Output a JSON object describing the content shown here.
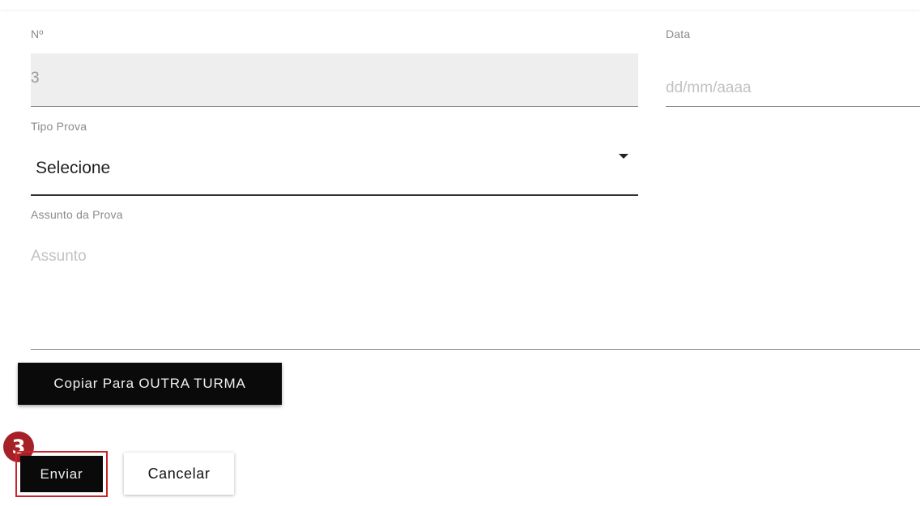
{
  "form": {
    "numero": {
      "label": "Nº",
      "value": "3"
    },
    "data": {
      "label": "Data",
      "placeholder": "dd/mm/aaaa"
    },
    "tipo_prova": {
      "label": "Tipo Prova",
      "selected": "Selecione"
    },
    "assunto": {
      "label": "Assunto da Prova",
      "placeholder": "Assunto"
    }
  },
  "actions": {
    "copiar_label": "Copiar Para OUTRA TURMA",
    "enviar_label": "Enviar",
    "cancelar_label": "Cancelar"
  },
  "annotation": {
    "step_number": "3",
    "highlight_color": "#c8242b",
    "badge_color": "#a62127"
  },
  "icons": {
    "select_caret": "caret-down-icon"
  }
}
